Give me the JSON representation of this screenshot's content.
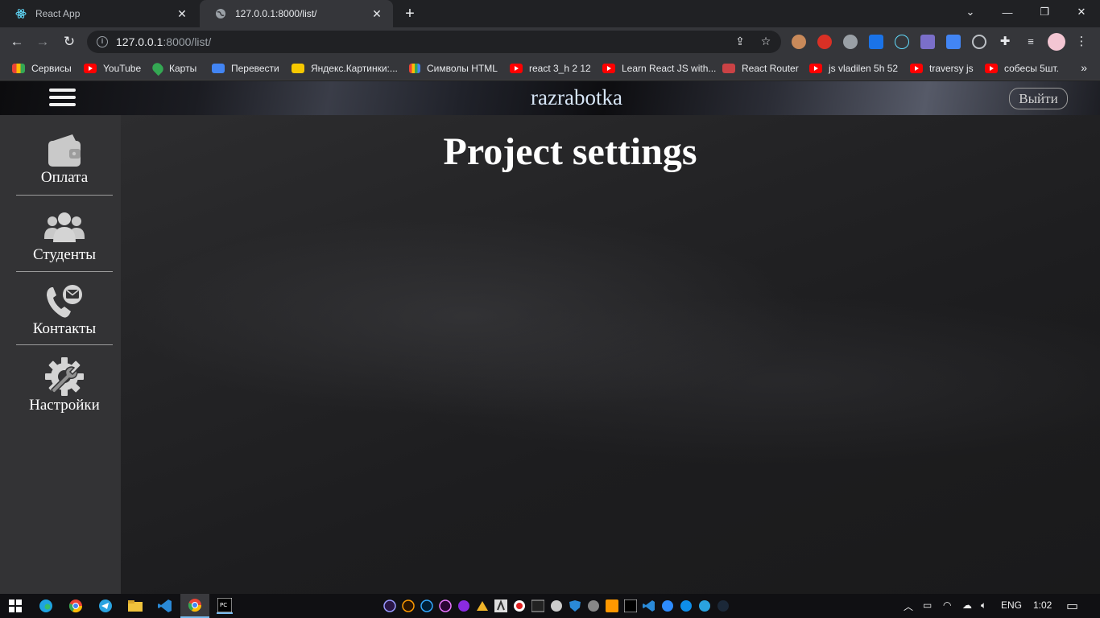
{
  "browser": {
    "tabs": [
      {
        "title": "React App",
        "active": false
      },
      {
        "title": "127.0.0.1:8000/list/",
        "active": true
      }
    ],
    "url_host": "127.0.0.1",
    "url_path": ":8000/list/",
    "bookmarks": [
      {
        "label": "Сервисы",
        "icon": "apps-grid-icon"
      },
      {
        "label": "YouTube",
        "icon": "youtube-icon"
      },
      {
        "label": "Карты",
        "icon": "maps-pin-icon"
      },
      {
        "label": "Перевести",
        "icon": "translate-icon"
      },
      {
        "label": "Яндекс.Картинки:...",
        "icon": "yandex-images-icon"
      },
      {
        "label": "Символы HTML",
        "icon": "html-symbols-icon"
      },
      {
        "label": "react 3_h 2 12",
        "icon": "youtube-icon"
      },
      {
        "label": "Learn React JS with...",
        "icon": "youtube-icon"
      },
      {
        "label": "React Router",
        "icon": "react-router-icon"
      },
      {
        "label": "js vladilen 5h 52",
        "icon": "youtube-icon"
      },
      {
        "label": "traversy js",
        "icon": "youtube-icon"
      },
      {
        "label": "собесы 5шт.",
        "icon": "youtube-icon"
      }
    ]
  },
  "app": {
    "brand": "razrabotka",
    "logout": "Выйти",
    "page_title": "Project settings",
    "sidebar": [
      {
        "label": "Оплата",
        "icon": "wallet-icon"
      },
      {
        "label": "Студенты",
        "icon": "users-icon"
      },
      {
        "label": "Контакты",
        "icon": "phone-mail-icon"
      },
      {
        "label": "Настройки",
        "icon": "settings-gear-icon"
      }
    ]
  },
  "taskbar": {
    "language": "ENG",
    "time": "1:02"
  }
}
